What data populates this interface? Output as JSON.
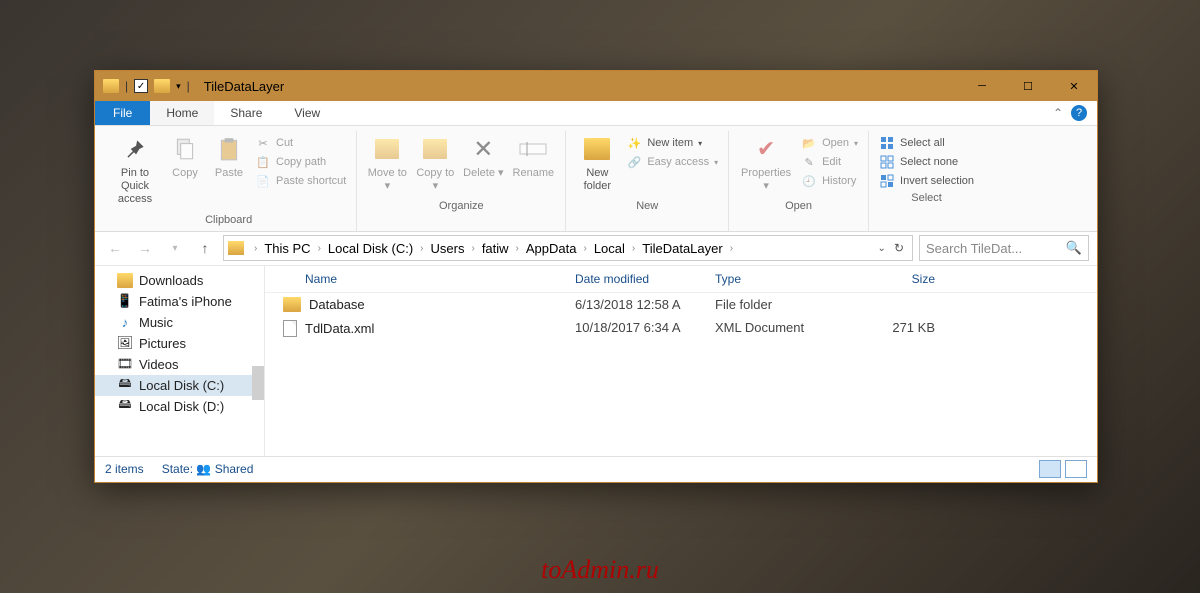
{
  "title": "TileDataLayer",
  "menu": {
    "file": "File",
    "home": "Home",
    "share": "Share",
    "view": "View"
  },
  "ribbon": {
    "pin": "Pin to Quick access",
    "copy": "Copy",
    "paste": "Paste",
    "cut": "Cut",
    "copypath": "Copy path",
    "pasteshortcut": "Paste shortcut",
    "clipboard": "Clipboard",
    "moveto": "Move to",
    "copyto": "Copy to",
    "delete": "Delete",
    "rename": "Rename",
    "organize": "Organize",
    "newfolder": "New folder",
    "newitem": "New item",
    "easyaccess": "Easy access",
    "new": "New",
    "properties": "Properties",
    "open": "Open",
    "edit": "Edit",
    "history": "History",
    "opengrp": "Open",
    "selectall": "Select all",
    "selectnone": "Select none",
    "invert": "Invert selection",
    "select": "Select"
  },
  "breadcrumb": [
    "This PC",
    "Local Disk (C:)",
    "Users",
    "fatiw",
    "AppData",
    "Local",
    "TileDataLayer"
  ],
  "search_placeholder": "Search TileDat...",
  "sidebar": {
    "items": [
      {
        "label": "Downloads"
      },
      {
        "label": "Fatima's iPhone"
      },
      {
        "label": "Music"
      },
      {
        "label": "Pictures"
      },
      {
        "label": "Videos"
      },
      {
        "label": "Local Disk (C:)"
      },
      {
        "label": "Local Disk (D:)"
      }
    ]
  },
  "columns": {
    "name": "Name",
    "date": "Date modified",
    "type": "Type",
    "size": "Size"
  },
  "files": [
    {
      "name": "Database",
      "date": "6/13/2018 12:58 A",
      "type": "File folder",
      "size": "",
      "kind": "folder"
    },
    {
      "name": "TdlData.xml",
      "date": "10/18/2017 6:34 A",
      "type": "XML Document",
      "size": "271 KB",
      "kind": "file"
    }
  ],
  "status": {
    "count": "2 items",
    "state_label": "State:",
    "state_value": "Shared"
  }
}
